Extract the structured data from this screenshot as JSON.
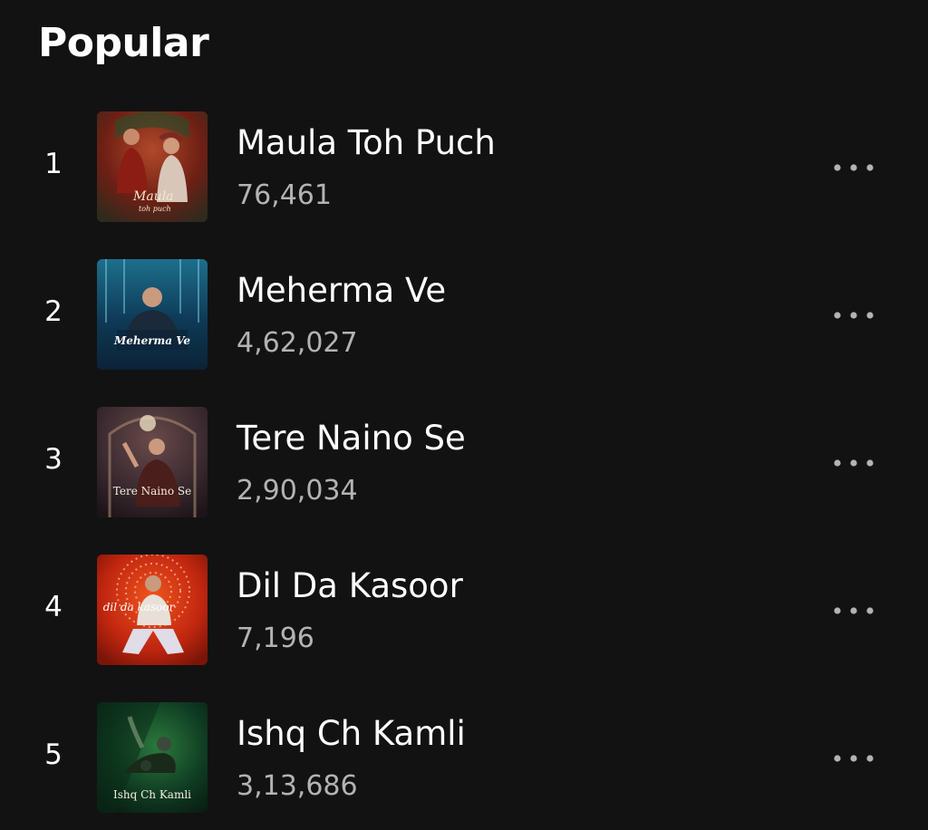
{
  "section": {
    "title": "Popular"
  },
  "tracks": [
    {
      "rank": "1",
      "title": "Maula Toh Puch",
      "plays": "76,461",
      "cover_text": [
        "Maula",
        "toh puch"
      ],
      "more_icon": "more-horizontal-icon",
      "cover_colors": [
        "#6e1f14",
        "#b0492a",
        "#2f2a1e"
      ]
    },
    {
      "rank": "2",
      "title": "Meherma Ve",
      "plays": "4,62,027",
      "cover_text": [
        "Meherma Ve"
      ],
      "more_icon": "more-horizontal-icon",
      "cover_colors": [
        "#0e3a56",
        "#1d6f8c",
        "#0b2236"
      ]
    },
    {
      "rank": "3",
      "title": "Tere Naino Se",
      "plays": "2,90,034",
      "cover_text": [
        "Tere Naino Se"
      ],
      "more_icon": "more-horizontal-icon",
      "cover_colors": [
        "#3a2a30",
        "#6a4a4a",
        "#1c1418"
      ]
    },
    {
      "rank": "4",
      "title": "Dil Da Kasoor",
      "plays": "7,196",
      "cover_text": [
        "dil da kasoor"
      ],
      "more_icon": "more-horizontal-icon",
      "cover_colors": [
        "#c0260f",
        "#f0551c",
        "#7a1508"
      ]
    },
    {
      "rank": "5",
      "title": "Ishq Ch Kamli",
      "plays": "3,13,686",
      "cover_text": [
        "Ishq Ch Kamli"
      ],
      "more_icon": "more-horizontal-icon",
      "cover_colors": [
        "#0f3a22",
        "#2b7a3c",
        "#081a10"
      ]
    }
  ]
}
